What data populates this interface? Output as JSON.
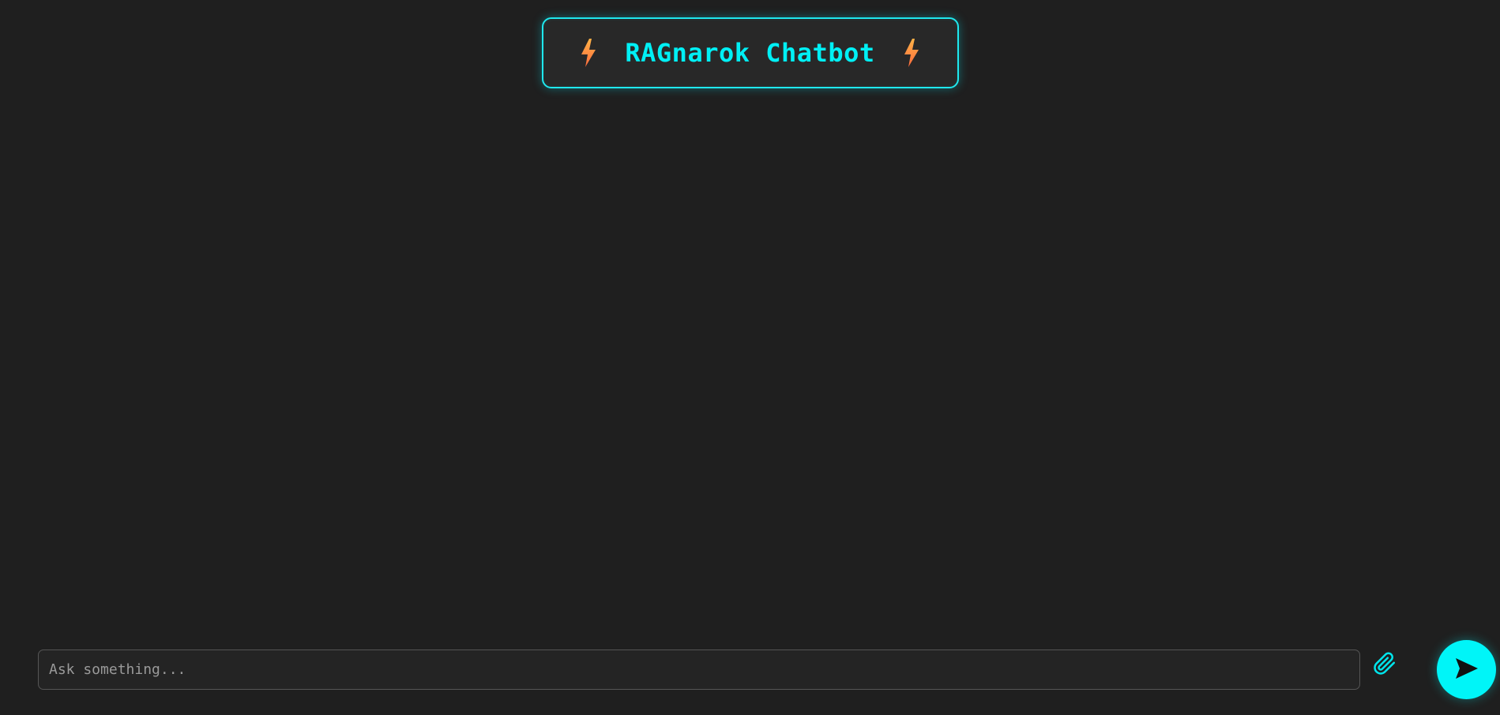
{
  "header": {
    "title": "RAGnarok Chatbot",
    "left_icon": "lightning-bolt-icon",
    "right_icon": "lightning-bolt-icon"
  },
  "composer": {
    "placeholder": "Ask something...",
    "value": "",
    "attach_icon": "paperclip-icon",
    "send_icon": "send-arrow-icon"
  },
  "colors": {
    "background": "#1f1f1f",
    "accent": "#00f0f5",
    "title_border": "#1fe8ee",
    "bolt_top": "#ffb347",
    "bolt_bottom": "#ff6b3d",
    "input_border": "#555555"
  }
}
